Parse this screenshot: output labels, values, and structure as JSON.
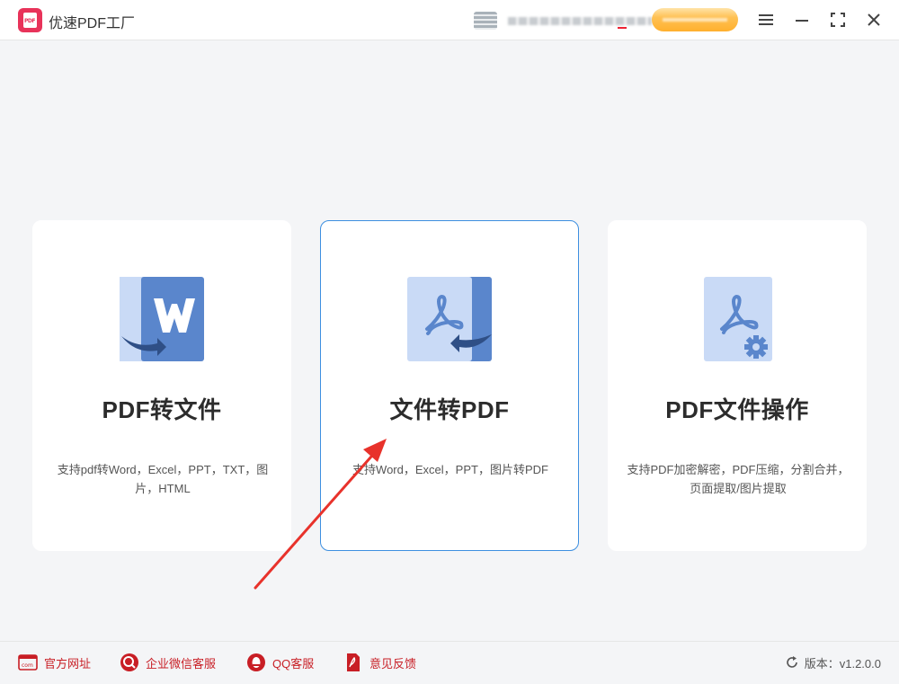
{
  "app": {
    "title": "优速PDF工厂",
    "logo_text": "PDF"
  },
  "cards": [
    {
      "title": "PDF转文件",
      "desc": "支持pdf转Word，Excel，PPT，TXT，图片，HTML",
      "icon": "pdf-to-word-icon"
    },
    {
      "title": "文件转PDF",
      "desc": "支持Word，Excel，PPT，图片转PDF",
      "icon": "file-to-pdf-icon"
    },
    {
      "title": "PDF文件操作",
      "desc": "支持PDF加密解密，PDF压缩，分割合并，页面提取/图片提取",
      "icon": "pdf-operations-icon"
    }
  ],
  "footer": {
    "website": "官方网址",
    "wecom": "企业微信客服",
    "qq": "QQ客服",
    "feedback": "意见反馈",
    "website_icon_text": "com",
    "version": "版本：v1.2.0.0"
  },
  "colors": {
    "accent_red": "#c81e25",
    "card_border_active": "#3d8fe0",
    "icon_blue": "#5a86cc",
    "icon_light": "#c9daf6",
    "vip_orange": "#ffb02e",
    "annotation_arrow": "#e8322b"
  }
}
